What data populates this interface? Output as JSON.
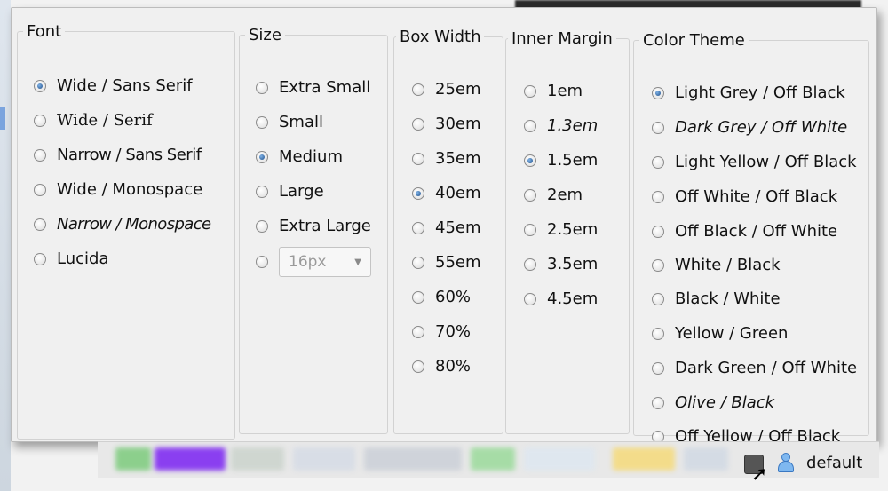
{
  "font": {
    "legend": "Font",
    "options": [
      "Wide / Sans Serif",
      "Wide / Serif",
      "Narrow / Sans Serif",
      "Wide / Monospace",
      "Narrow / Monospace",
      "Lucida"
    ],
    "selected": "Wide / Sans Serif"
  },
  "size": {
    "legend": "Size",
    "options": [
      "Extra Small",
      "Small",
      "Medium",
      "Large",
      "Extra Large"
    ],
    "selected": "Medium",
    "custom_value": "16px"
  },
  "box_width": {
    "legend": "Box Width",
    "options": [
      "25em",
      "30em",
      "35em",
      "40em",
      "45em",
      "55em",
      "60%",
      "70%",
      "80%"
    ],
    "selected": "40em"
  },
  "inner_margin": {
    "legend": "Inner Margin",
    "options": [
      "1em",
      "1.3em",
      "1.5em",
      "2em",
      "2.5em",
      "3.5em",
      "4.5em"
    ],
    "selected": "1.5em"
  },
  "color_theme": {
    "legend": "Color Theme",
    "options": [
      "Light Grey / Off Black",
      "Dark Grey / Off White",
      "Light Yellow / Off Black",
      "Off White / Off Black",
      "Off Black / Off White",
      "White / Black",
      "Black / White",
      "Yellow / Green",
      "Dark Green / Off White",
      "Olive / Black",
      "Off Yellow / Off Black"
    ],
    "selected": "Light Grey / Off Black"
  },
  "statusbar": {
    "user_label": "default",
    "icons": [
      "user-icon",
      "tray-button-icon"
    ]
  },
  "colors": {
    "panel_bg": "#f0f0f0",
    "radio_checked": "#1f4f8a",
    "user_icon": "#7fb8f0"
  }
}
